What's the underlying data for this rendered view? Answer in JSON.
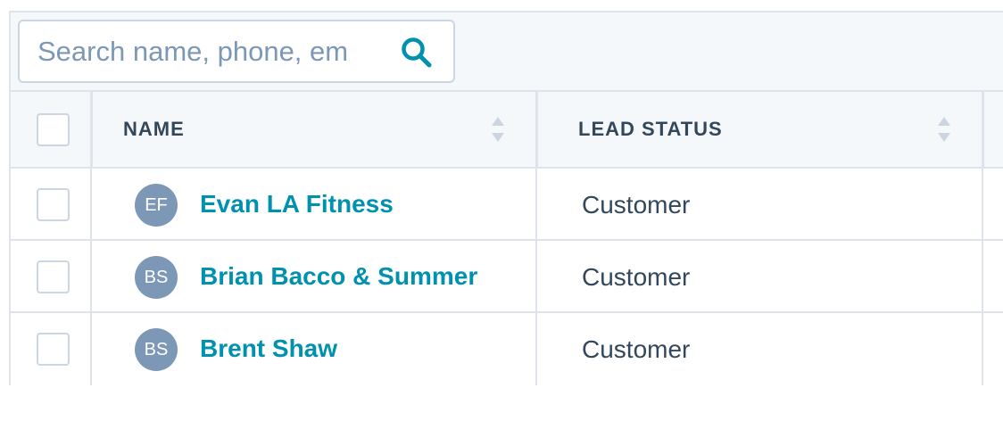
{
  "search": {
    "placeholder": "Search name, phone, em"
  },
  "table": {
    "columns": [
      {
        "label": "NAME",
        "sortable": true
      },
      {
        "label": "LEAD STATUS",
        "sortable": true
      }
    ],
    "rows": [
      {
        "initials": "EF",
        "name": "Evan LA Fitness",
        "lead_status": "Customer"
      },
      {
        "initials": "BS",
        "name": "Brian Bacco & Summer",
        "lead_status": "Customer"
      },
      {
        "initials": "BS",
        "name": "Brent Shaw",
        "lead_status": "Customer"
      }
    ]
  },
  "colors": {
    "link": "#0091ae",
    "text": "#33475b",
    "avatar": "#7c98b6",
    "header_bg": "#f5f8fa",
    "border": "#dfe3eb"
  },
  "icons": {
    "search": "search-icon",
    "sort": "sort-icon"
  }
}
